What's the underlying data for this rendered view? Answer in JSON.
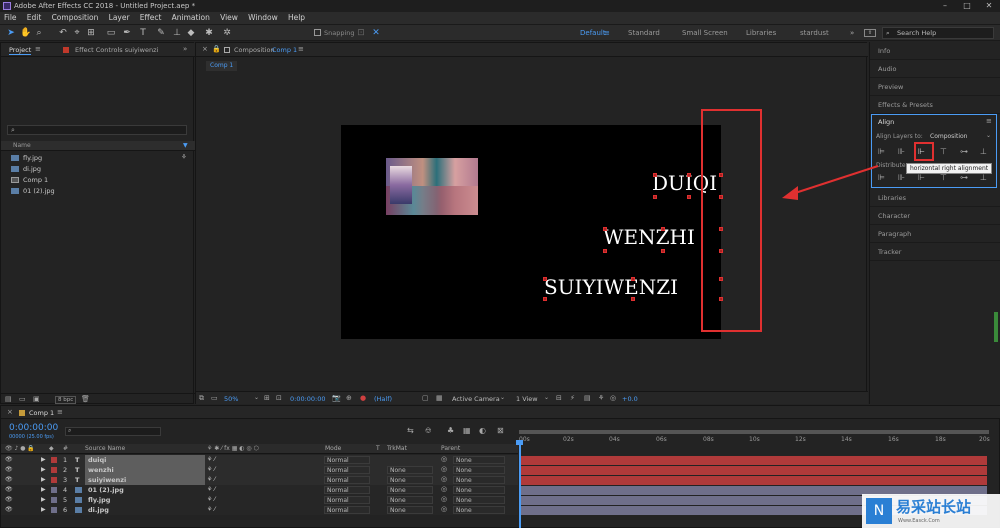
{
  "window": {
    "title": "Adobe After Effects CC 2018 - Untitled Project.aep *",
    "controls": [
      "–",
      "□",
      "✕"
    ]
  },
  "menu": [
    "File",
    "Edit",
    "Composition",
    "Layer",
    "Effect",
    "Animation",
    "View",
    "Window",
    "Help"
  ],
  "toolbar": {
    "snapping_label": "Snapping",
    "workspaces": [
      "Default",
      "Standard",
      "Small Screen",
      "Libraries",
      "stardust"
    ],
    "active_workspace": "Default",
    "search_placeholder": "Search Help"
  },
  "project_panel": {
    "tab_project": "Project",
    "tab_effect_controls": "Effect Controls suiyiwenzi",
    "search_placeholder": "",
    "column_name": "Name",
    "items": [
      {
        "name": "fly.jpg",
        "icon": "image-file-icon"
      },
      {
        "name": "di.jpg",
        "icon": "image-file-icon"
      },
      {
        "name": "Comp 1",
        "icon": "composition-icon"
      },
      {
        "name": "01 (2).jpg",
        "icon": "image-file-icon"
      }
    ],
    "bpc": "8 bpc"
  },
  "composition_panel": {
    "tab_label": "Composition",
    "tab_comp_name": "Comp 1",
    "breadcrumb": "Comp 1",
    "canvas_texts": [
      "DUIQI",
      "WENZHI",
      "SUIYIWENZI"
    ],
    "footer": {
      "zoom": "50%",
      "timecode": "0:00:00:00",
      "resolution": "(Half)",
      "camera": "Active Camera",
      "view": "1 View",
      "exposure": "+0.0"
    }
  },
  "right_panel": {
    "items_top": [
      "Info",
      "Audio",
      "Preview",
      "Effects & Presets"
    ],
    "align": {
      "title": "Align",
      "align_layers_to_label": "Align Layers to:",
      "align_layers_to_value": "Composition",
      "distribute_label": "Distribute",
      "tooltip": "horizontal right alignment"
    },
    "items_bottom": [
      "Libraries",
      "Character",
      "Paragraph",
      "Tracker"
    ]
  },
  "timeline": {
    "comp_tab": "Comp 1",
    "timecode": "0:00:00:00",
    "frame_info": "00000 (25.00 fps)",
    "search_placeholder": "",
    "columns": {
      "number": "#",
      "source_name": "Source Name",
      "mode": "Mode",
      "t": "T",
      "trkmat": "TrkMat",
      "parent": "Parent"
    },
    "ruler": [
      "00s",
      "02s",
      "04s",
      "06s",
      "08s",
      "10s",
      "12s",
      "14s",
      "16s",
      "18s",
      "20s"
    ],
    "layers": [
      {
        "num": "1",
        "type": "T",
        "name": "duiqi",
        "mode": "Normal",
        "trkmat": "",
        "parent": "None",
        "color": "#b03a3a"
      },
      {
        "num": "2",
        "type": "T",
        "name": "wenzhi",
        "mode": "Normal",
        "trkmat": "None",
        "parent": "None",
        "color": "#b03a3a"
      },
      {
        "num": "3",
        "type": "T",
        "name": "suiyiwenzi",
        "mode": "Normal",
        "trkmat": "None",
        "parent": "None",
        "color": "#b03a3a"
      },
      {
        "num": "4",
        "type": "img",
        "name": "01 (2).jpg",
        "mode": "Normal",
        "trkmat": "None",
        "parent": "None",
        "color": "#6f6f8a"
      },
      {
        "num": "5",
        "type": "img",
        "name": "fly.jpg",
        "mode": "Normal",
        "trkmat": "None",
        "parent": "None",
        "color": "#6f6f8a"
      },
      {
        "num": "6",
        "type": "img",
        "name": "di.jpg",
        "mode": "Normal",
        "trkmat": "None",
        "parent": "None",
        "color": "#6f6f8a"
      }
    ]
  },
  "watermark": {
    "brand": "易采站长站",
    "url": "Www.Easck.Com"
  },
  "colors": {
    "accent_blue": "#4b9cf5",
    "annotation_red": "#e03030",
    "text_layer_bar": "#b03a3a",
    "image_layer_bar": "#6f6f8a"
  }
}
